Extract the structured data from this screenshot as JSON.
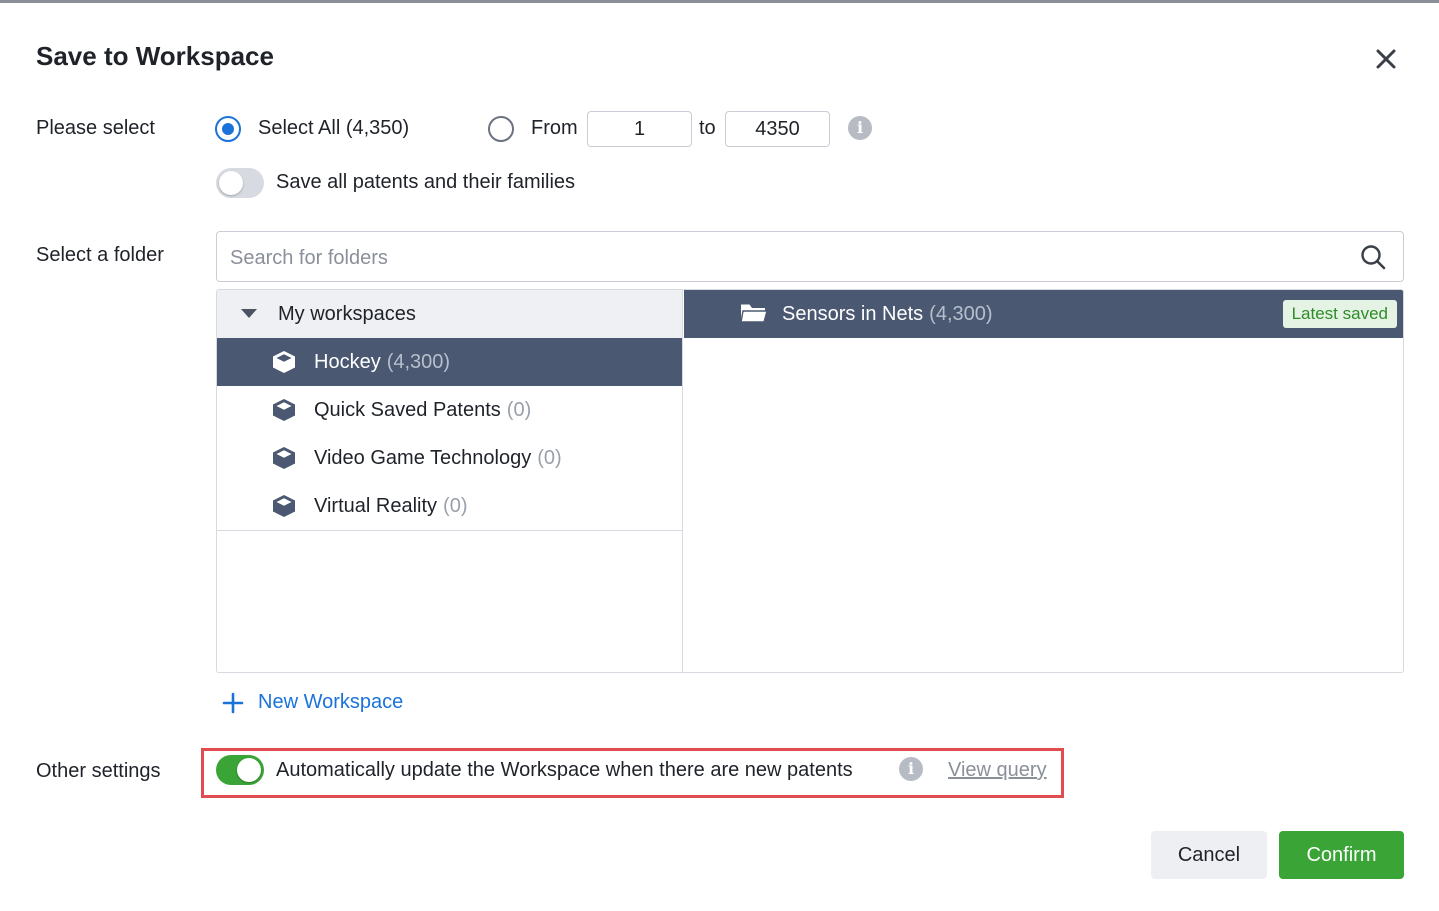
{
  "dialog": {
    "title": "Save to Workspace"
  },
  "selection": {
    "label": "Please select",
    "select_all_label": "Select All (4,350)",
    "select_all_checked": true,
    "from_label": "From",
    "from_value": "1",
    "to_label": "to",
    "to_value": "4350",
    "families_toggle_label": "Save all patents and their families",
    "families_toggle_on": false
  },
  "folder": {
    "label": "Select a folder",
    "search_placeholder": "Search for folders",
    "root_label": "My workspaces",
    "workspaces": [
      {
        "name": "Hockey",
        "count": "(4,300)",
        "selected": true
      },
      {
        "name": "Quick Saved Patents",
        "count": "(0)",
        "selected": false
      },
      {
        "name": "Video Game Technology",
        "count": "(0)",
        "selected": false
      },
      {
        "name": "Virtual Reality",
        "count": "(0)",
        "selected": false
      }
    ],
    "subfolders": [
      {
        "name": "Sensors in Nets",
        "count": "(4,300)",
        "badge": "Latest saved"
      }
    ],
    "new_workspace_label": "New Workspace"
  },
  "other_settings": {
    "label": "Other settings",
    "auto_update_label": "Automatically update the Workspace when there are new patents",
    "auto_update_on": true,
    "view_query_label": "View query"
  },
  "actions": {
    "cancel_label": "Cancel",
    "confirm_label": "Confirm"
  },
  "colors": {
    "accent_blue": "#1a73d9",
    "selected_row": "#4a5872",
    "confirm_green": "#3aa536",
    "highlight_red": "#e14c50",
    "badge_green_text": "#2e8b2a",
    "badge_green_bg": "#e5f3e4"
  }
}
